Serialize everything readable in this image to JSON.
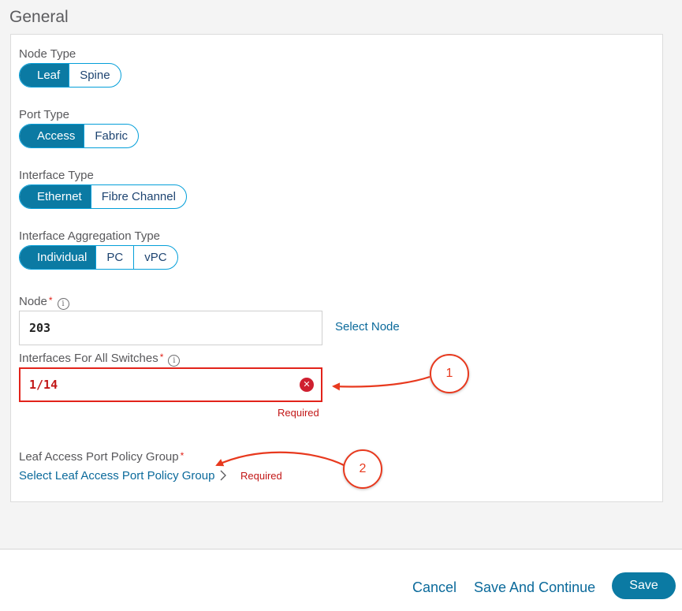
{
  "section": {
    "title": "General"
  },
  "node_type": {
    "label": "Node Type",
    "options": [
      "Leaf",
      "Spine"
    ],
    "selected": "Leaf"
  },
  "port_type": {
    "label": "Port Type",
    "options": [
      "Access",
      "Fabric"
    ],
    "selected": "Access"
  },
  "interface_type": {
    "label": "Interface Type",
    "options": [
      "Ethernet",
      "Fibre Channel"
    ],
    "selected": "Ethernet"
  },
  "aggregation_type": {
    "label": "Interface Aggregation Type",
    "options": [
      "Individual",
      "PC",
      "vPC"
    ],
    "selected": "Individual"
  },
  "node": {
    "label": "Node",
    "required_marker": "*",
    "info_glyph": "i",
    "value": "203",
    "select_link": "Select Node"
  },
  "interfaces": {
    "label": "Interfaces For All Switches",
    "required_marker": "*",
    "info_glyph": "i",
    "value": "1/14",
    "clear_glyph": "✕",
    "error": "Required"
  },
  "policy_group": {
    "label": "Leaf Access Port Policy Group",
    "required_marker": "*",
    "select_link": "Select Leaf Access Port Policy Group",
    "error": "Required"
  },
  "annotations": {
    "one": "1",
    "two": "2"
  },
  "footer": {
    "cancel": "Cancel",
    "save_continue": "Save And Continue",
    "save": "Save"
  },
  "colors": {
    "accent": "#0b7aa3",
    "link": "#0b6a9b",
    "error": "#e2231a",
    "annotation": "#e8391e"
  }
}
